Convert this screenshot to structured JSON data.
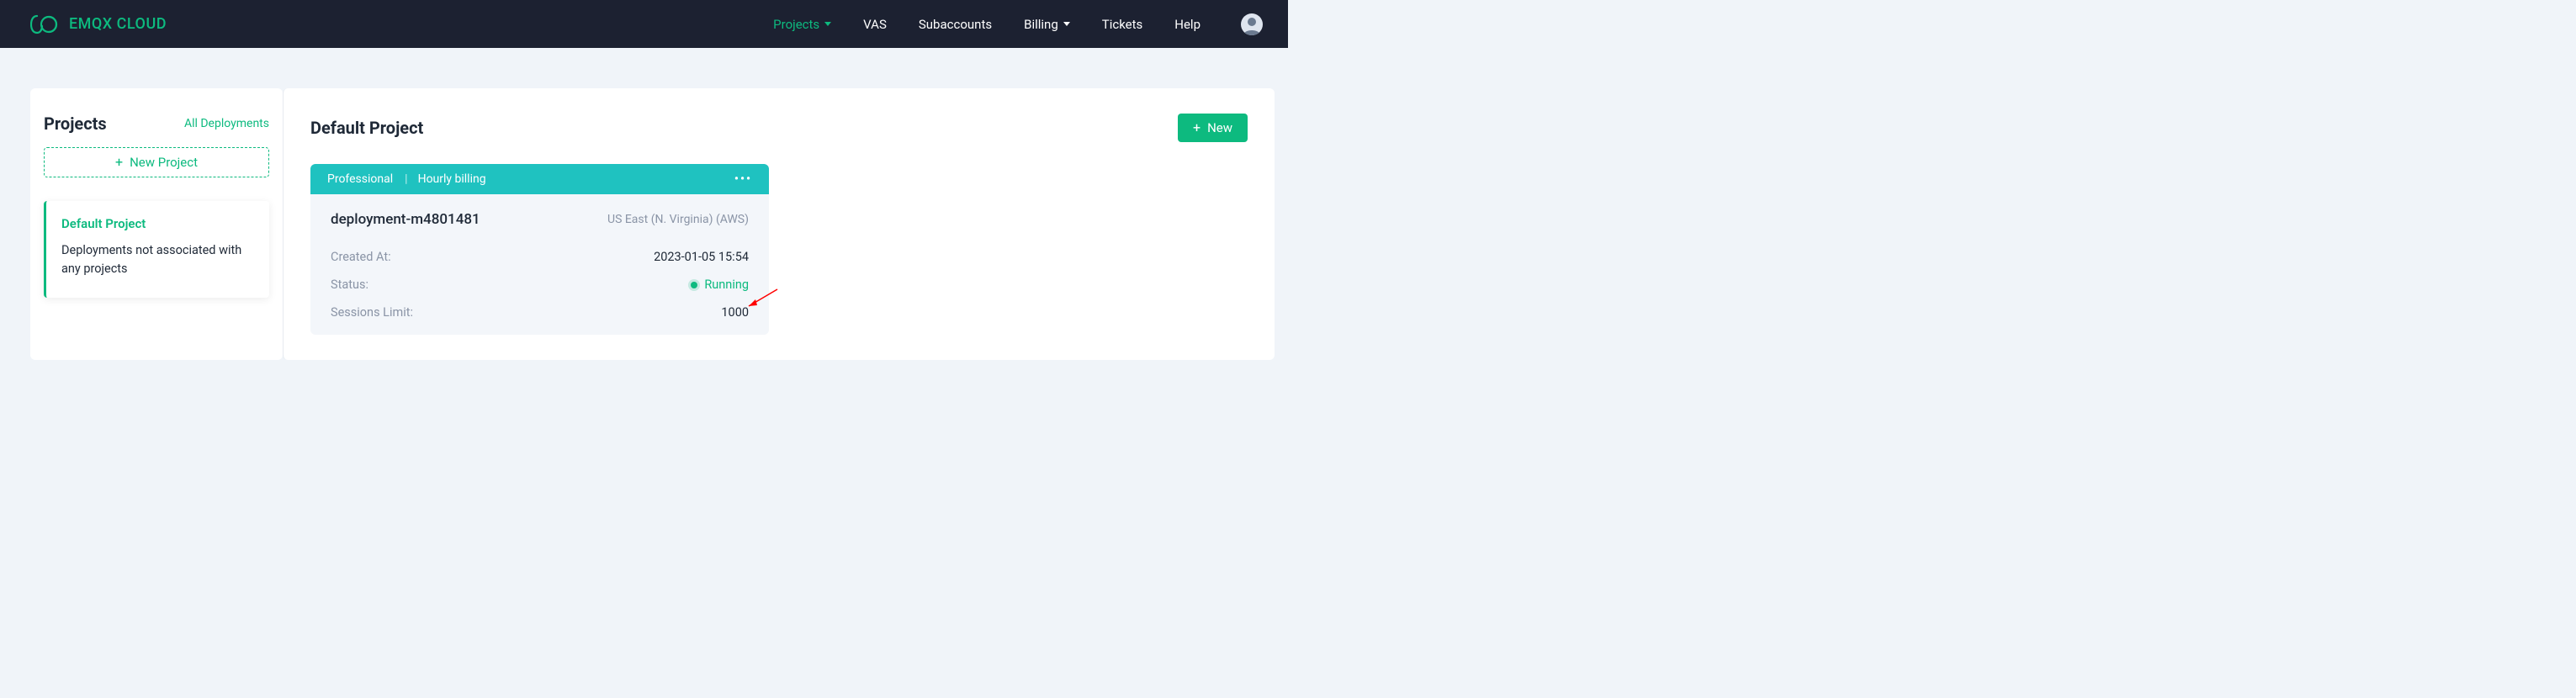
{
  "brand": "EMQX CLOUD",
  "nav": {
    "projects": "Projects",
    "vas": "VAS",
    "subaccounts": "Subaccounts",
    "billing": "Billing",
    "tickets": "Tickets",
    "help": "Help"
  },
  "sidebar": {
    "title": "Projects",
    "all_deployments": "All Deployments",
    "new_project": "New Project",
    "default_project": {
      "title": "Default Project",
      "desc": "Deployments not associated with any projects"
    }
  },
  "content": {
    "title": "Default Project",
    "new_btn": "New"
  },
  "deployment": {
    "plan": "Professional",
    "billing": "Hourly billing",
    "name": "deployment-m4801481",
    "region": "US East (N. Virginia) (AWS)",
    "created_at_label": "Created At:",
    "created_at": "2023-01-05 15:54",
    "status_label": "Status:",
    "status": "Running",
    "sessions_label": "Sessions Limit:",
    "sessions": "1000"
  }
}
